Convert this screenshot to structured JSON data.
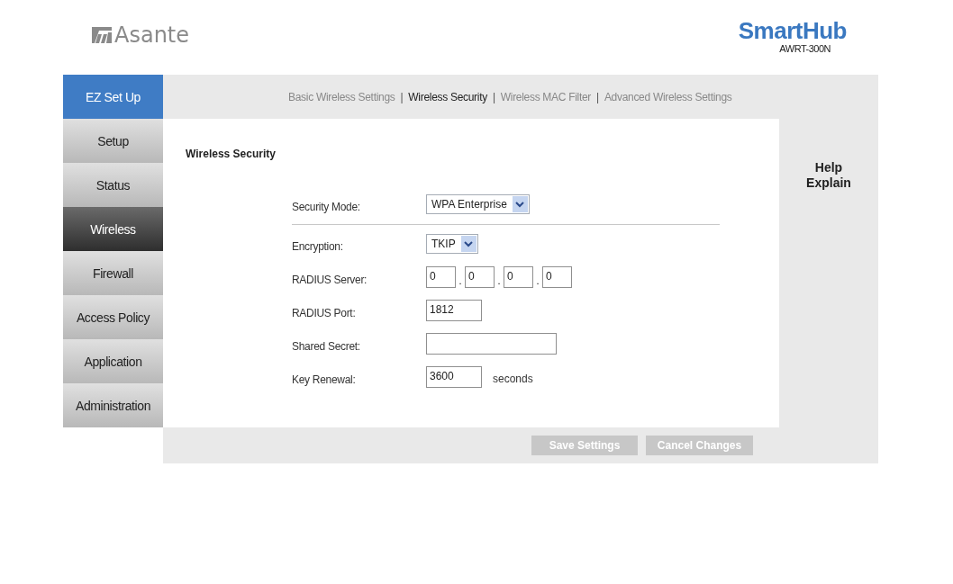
{
  "header": {
    "brand": "Asante",
    "product": "SmartHub",
    "model": "AWRT-300N"
  },
  "sidebar": {
    "items": [
      {
        "label": "EZ Set Up",
        "kind": "wizard",
        "selected": false
      },
      {
        "label": "Setup",
        "kind": "menu",
        "selected": false
      },
      {
        "label": "Status",
        "kind": "menu",
        "selected": false
      },
      {
        "label": "Wireless",
        "kind": "menu",
        "selected": true
      },
      {
        "label": "Firewall",
        "kind": "menu",
        "selected": false
      },
      {
        "label": "Access Policy",
        "kind": "menu",
        "selected": false
      },
      {
        "label": "Application",
        "kind": "menu",
        "selected": false
      },
      {
        "label": "Administration",
        "kind": "menu",
        "selected": false
      }
    ]
  },
  "subnav_separators": [
    "|",
    "|",
    "|"
  ],
  "subnav": [
    {
      "label": "Basic Wireless Settings",
      "selected": false
    },
    {
      "label": "Wireless Security",
      "selected": true
    },
    {
      "label": "Wireless MAC Filter",
      "selected": false
    },
    {
      "label": "Advanced Wireless Settings",
      "selected": false
    }
  ],
  "section_title": "Wireless Security",
  "form": [
    {
      "kind": "select",
      "label": "Security Mode:",
      "value": "WPA Enterprise",
      "divider_after": true
    },
    {
      "kind": "select",
      "label": "Encryption:",
      "value": "TKIP"
    },
    {
      "kind": "ip",
      "label": "RADIUS Server:",
      "octets": [
        "0",
        "0",
        "0",
        "0"
      ],
      "separators": [
        ".",
        ".",
        "."
      ]
    },
    {
      "kind": "number",
      "label": "RADIUS Port:",
      "value": "1812"
    },
    {
      "kind": "text",
      "label": "Shared Secret:"
    },
    {
      "kind": "number",
      "label": "Key Renewal:",
      "value": "3600",
      "suffix": "seconds"
    }
  ],
  "help": {
    "title": "Help",
    "link": "Explain"
  },
  "buttons": [
    {
      "label": "Save Settings",
      "disabled": true
    },
    {
      "label": "Cancel Changes",
      "disabled": true
    }
  ]
}
